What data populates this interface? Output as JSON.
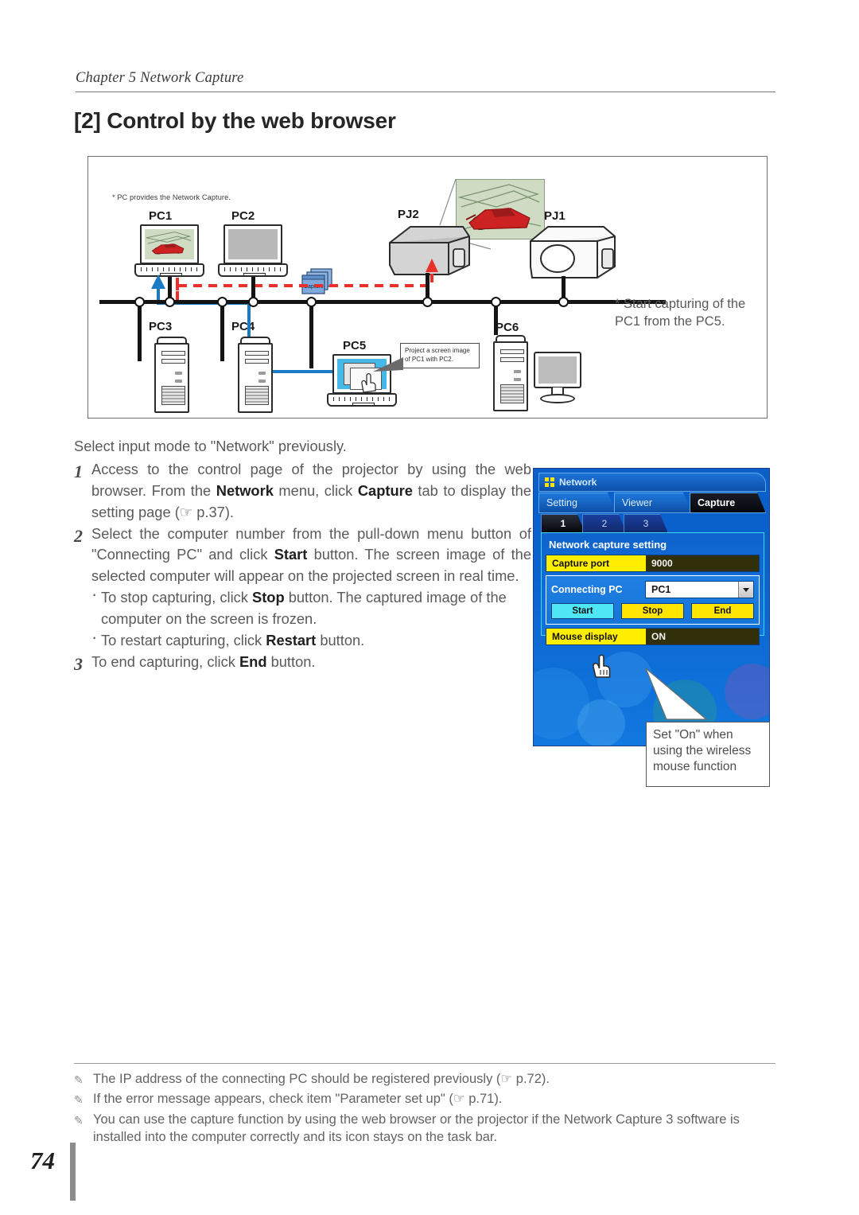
{
  "header": {
    "chapter": "Chapter 5 Network Capture",
    "title": "[2] Control by the web browser"
  },
  "diagram": {
    "footnote": "* PC provides the Network Capture.",
    "capture_icon_label": "Capture",
    "devices": [
      {
        "name": "PC1",
        "type": "laptop"
      },
      {
        "name": "PC2",
        "type": "laptop"
      },
      {
        "name": "PJ2",
        "type": "projector"
      },
      {
        "name": "PJ1",
        "type": "projector"
      },
      {
        "name": "PC3",
        "type": "tower"
      },
      {
        "name": "PC4",
        "type": "tower"
      },
      {
        "name": "PC5",
        "type": "laptop"
      },
      {
        "name": "PC6",
        "type": "desktop"
      }
    ],
    "callout_pc5": "Project a screen image of PC1 with PC2.",
    "side_note": "* Start capturing of the PC1 from the PC5."
  },
  "body": {
    "lead": "Select input mode to \"Network\" previously.",
    "steps": [
      {
        "num": "1",
        "parts": [
          {
            "t": "Access to the control page of the projector by using the web browser. From the ",
            "b": false
          },
          {
            "t": "Network",
            "b": true
          },
          {
            "t": " menu, click ",
            "b": false
          },
          {
            "t": "Capture",
            "b": true
          },
          {
            "t": " tab to display the setting page (",
            "b": false
          },
          {
            "t": "☞",
            "b": false
          },
          {
            "t": " p.37).",
            "b": false
          }
        ]
      },
      {
        "num": "2",
        "parts": [
          {
            "t": "Select the computer number from the pull-down menu button of \"Connecting PC\" and click ",
            "b": false
          },
          {
            "t": "Start",
            "b": true
          },
          {
            "t": " button. The screen image of the selected computer will appear on the projected screen in real time.",
            "b": false
          }
        ]
      },
      {
        "num": "3",
        "parts": [
          {
            "t": "To end capturing, click ",
            "b": false
          },
          {
            "t": "End",
            "b": true
          },
          {
            "t": " button.",
            "b": false
          }
        ]
      }
    ],
    "bullets": [
      [
        {
          "t": "To stop capturing, click ",
          "b": false
        },
        {
          "t": "Stop",
          "b": true
        },
        {
          "t": " button. The captured image of the computer on the screen is frozen.",
          "b": false
        }
      ],
      [
        {
          "t": "To restart capturing, click ",
          "b": false
        },
        {
          "t": "Restart",
          "b": true
        },
        {
          "t": " button.",
          "b": false
        }
      ]
    ]
  },
  "screenshot": {
    "window_title": "Network",
    "tabs": [
      {
        "label": "Setting",
        "active": false
      },
      {
        "label": "Viewer",
        "active": false
      },
      {
        "label": "Capture",
        "active": true
      }
    ],
    "subtabs": [
      {
        "label": "1",
        "active": true
      },
      {
        "label": "2",
        "active": false
      },
      {
        "label": "3",
        "active": false
      }
    ],
    "panel_title": "Network capture setting",
    "capture_port": {
      "label": "Capture port",
      "value": "9000"
    },
    "connecting_pc": {
      "label": "Connecting PC",
      "value": "PC1"
    },
    "buttons": [
      {
        "label": "Start",
        "state": "hover"
      },
      {
        "label": "Stop",
        "state": "normal"
      },
      {
        "label": "End",
        "state": "normal"
      }
    ],
    "mouse_display": {
      "label": "Mouse display",
      "value": "ON"
    },
    "callout": "Set \"On\" when using the wireless mouse function",
    "colors": {
      "label_yellow": "#ffee00",
      "value_dark": "#31300a",
      "hover_cyan": "#4fe6f5",
      "panel_blue": "#0f63cd",
      "accent_cyan": "#43d6f2"
    }
  },
  "footer": {
    "notes": [
      "The IP address of the connecting PC should be registered previously (☞ p.72).",
      "If the error message appears, check item \"Parameter set up\"  (☞ p.71).",
      "You can use the capture function by using the web browser or the projector if the Network Capture 3 software is installed into the computer correctly and its icon stays on the task bar."
    ],
    "page_number": "74"
  }
}
